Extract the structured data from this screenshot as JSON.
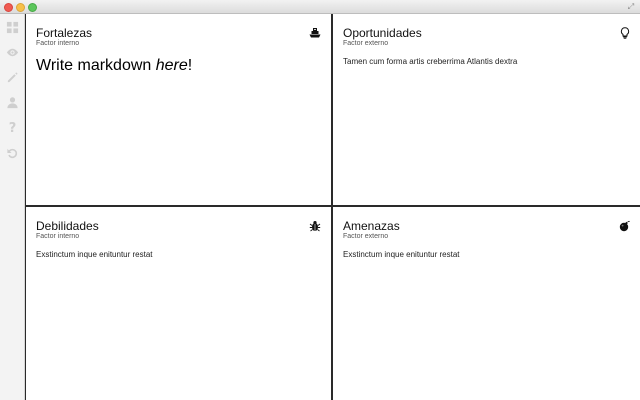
{
  "window": {
    "fullscreen_glyph": "⤢"
  },
  "sidebar": {
    "items": [
      {
        "name": "grid-icon"
      },
      {
        "name": "eye-icon"
      },
      {
        "name": "pencil-icon"
      },
      {
        "name": "user-icon"
      },
      {
        "name": "help-icon",
        "glyph": "?"
      },
      {
        "name": "undo-icon"
      }
    ]
  },
  "quadrants": {
    "strengths": {
      "title": "Fortalezas",
      "subtitle": "Factor interno",
      "body_prefix": "Write markdown ",
      "body_emph": "here",
      "body_suffix": "!",
      "icon": "ship-icon"
    },
    "opportunities": {
      "title": "Oportunidades",
      "subtitle": "Factor externo",
      "body": "Tamen cum forma artis creberrima Atlantis dextra",
      "icon": "lightbulb-icon"
    },
    "weaknesses": {
      "title": "Debilidades",
      "subtitle": "Factor interno",
      "body": "Exstinctum inque enituntur restat",
      "icon": "bug-icon"
    },
    "threats": {
      "title": "Amenazas",
      "subtitle": "Factor externo",
      "body": "Exstinctum inque enituntur restat",
      "icon": "bomb-icon"
    }
  },
  "colors": {
    "divider": "#2a2a2a",
    "sidebar_bg": "#f3f3f3",
    "sidebar_icon": "#cfcfcf"
  }
}
